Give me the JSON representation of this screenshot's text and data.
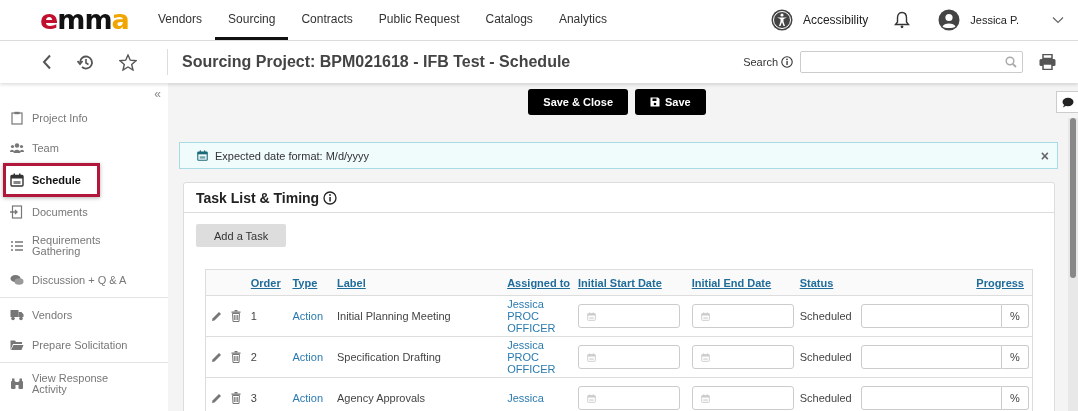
{
  "top_nav": {
    "logo": "emma",
    "items": [
      {
        "label": "Vendors",
        "selected": false
      },
      {
        "label": "Sourcing",
        "selected": true
      },
      {
        "label": "Contracts",
        "selected": false
      },
      {
        "label": "Public Request",
        "selected": false
      },
      {
        "label": "Catalogs",
        "selected": false
      },
      {
        "label": "Analytics",
        "selected": false
      }
    ],
    "accessibility": "Accessibility",
    "user": "Jessica P."
  },
  "toolbar": {
    "title": "Sourcing Project: BPM021618 - IFB Test - Schedule",
    "search_label": "Search"
  },
  "sidebar": {
    "collapse": "«",
    "groups": [
      [
        {
          "label": "Project Info",
          "selected": false
        },
        {
          "label": "Team",
          "selected": false
        },
        {
          "label": "Schedule",
          "selected": true
        },
        {
          "label": "Documents",
          "selected": false
        },
        {
          "label": "Requirements Gathering",
          "selected": false
        },
        {
          "label": "Discussion + Q & A",
          "selected": false
        }
      ],
      [
        {
          "label": "Vendors",
          "selected": false
        },
        {
          "label": "Prepare Solicitation",
          "selected": false
        }
      ],
      [
        {
          "label": "View Response Activity",
          "selected": false
        }
      ]
    ]
  },
  "actions": [
    "Save & Close",
    "Save"
  ],
  "alert": {
    "text": "Expected date format: M/d/yyyy",
    "close": "×"
  },
  "card": {
    "title": "Task List & Timing",
    "add_button": "Add a Task",
    "table": {
      "columns": [
        "Order",
        "Type",
        "Label",
        "Assigned to",
        "Initial Start Date",
        "Initial End Date",
        "Status",
        "Progress"
      ],
      "rows": [
        {
          "order": "1",
          "type": "Action",
          "label": "Initial Planning Meeting",
          "assigned_to": "Jessica PROC OFFICER",
          "status": "Scheduled",
          "progress_unit": "%"
        },
        {
          "order": "2",
          "type": "Action",
          "label": "Specification Drafting",
          "assigned_to": "Jessica PROC OFFICER",
          "status": "Scheduled",
          "progress_unit": "%"
        },
        {
          "order": "3",
          "type": "Action",
          "label": "Agency Approvals",
          "assigned_to": "Jessica",
          "status": "Scheduled",
          "progress_unit": "%"
        }
      ]
    }
  }
}
